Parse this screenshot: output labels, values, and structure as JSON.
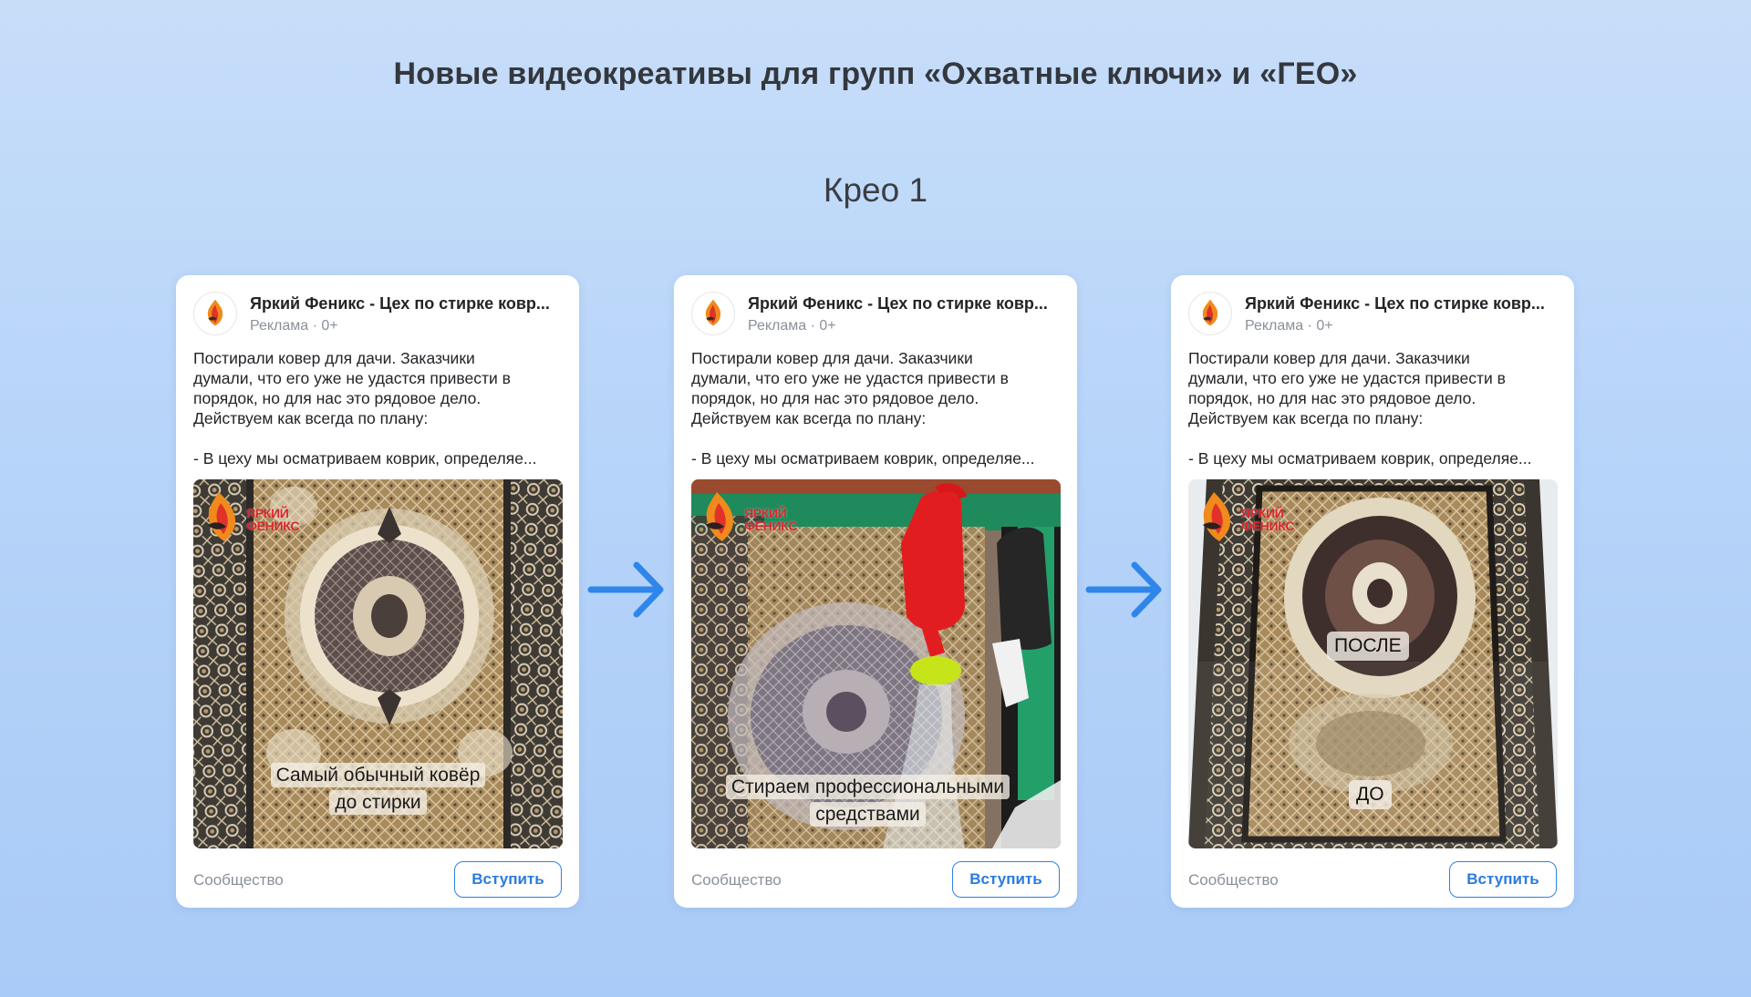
{
  "page": {
    "title": "Новые видеокреативы для групп «Охватные ключи» и «ГЕО»",
    "section_title": "Крео 1"
  },
  "cards": [
    {
      "channel_name": "Яркий Феникс - Цех по стирке ковр...",
      "ad_meta": "Реклама · 0+",
      "text_lines": [
        "Постирали ковер для дачи. Заказчики",
        "думали, что его уже не удастся привести в",
        "порядок, но для нас это рядовое дело.",
        "Действуем как всегда по плану:",
        "- В цеху мы осматриваем коврик, определяе..."
      ],
      "logo_text": [
        "ЯРКИЙ",
        "ФЕНИКС"
      ],
      "caption_lines": [
        "Самый обычный ковёр",
        "до стирки"
      ],
      "footer_label": "Сообщество",
      "join_label": "Вступить"
    },
    {
      "channel_name": "Яркий Феникс - Цех по стирке ковр...",
      "ad_meta": "Реклама · 0+",
      "text_lines": [
        "Постирали ковер для дачи. Заказчики",
        "думали, что его уже не удастся привести в",
        "порядок, но для нас это рядовое дело.",
        "Действуем как всегда по плану:",
        "- В цеху мы осматриваем коврик, определяе..."
      ],
      "logo_text": [
        "ЯРКИЙ",
        "ФЕНИКС"
      ],
      "caption_lines": [
        "Стираем профессиональными",
        "средствами"
      ],
      "footer_label": "Сообщество",
      "join_label": "Вступить"
    },
    {
      "channel_name": "Яркий Феникс - Цех по стирке ковр...",
      "ad_meta": "Реклама · 0+",
      "text_lines": [
        "Постирали ковер для дачи. Заказчики",
        "думали, что его уже не удастся привести в",
        "порядок, но для нас это рядовое дело.",
        "Действуем как всегда по плану:",
        "- В цеху мы осматриваем коврик, определяе..."
      ],
      "logo_text": [
        "ЯРКИЙ",
        "ФЕНИКС"
      ],
      "after_label": "ПОСЛЕ",
      "before_label": "ДО",
      "footer_label": "Сообщество",
      "join_label": "Вступить"
    }
  ],
  "icons": {
    "arrow": "arrow-right-icon",
    "avatar": "phoenix-logo-icon"
  },
  "colors": {
    "background_top": "#c7def9",
    "background_bottom": "#a9cbf7",
    "accent_blue": "#2d81e0",
    "arrow_blue": "#2f86ea",
    "logo_red": "#d9262b"
  }
}
